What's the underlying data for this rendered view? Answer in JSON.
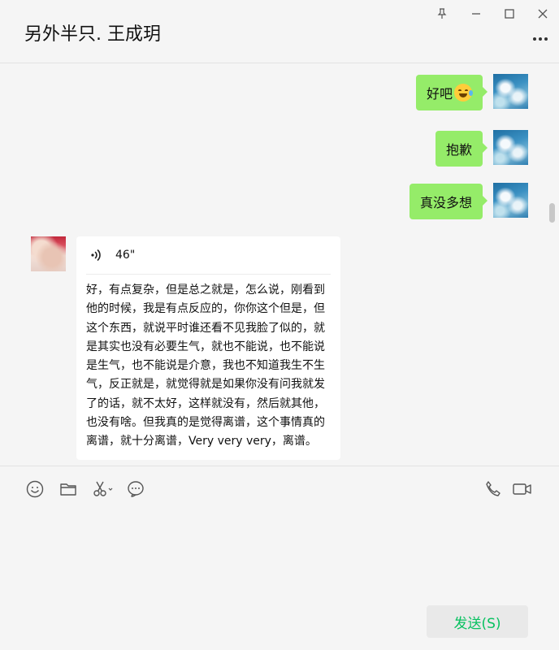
{
  "window": {
    "title": "另外半只. 王成玥",
    "controls": [
      "pin-icon",
      "minimize-icon",
      "maximize-icon",
      "close-icon",
      "more-icon"
    ]
  },
  "messages": {
    "outgoing": [
      {
        "text": "好吧",
        "emoji": "tears-of-joy-emoji"
      },
      {
        "text": "抱歉"
      },
      {
        "text": "真没多想"
      }
    ],
    "incoming": {
      "voice_duration": "46\"",
      "transcript": "好，有点复杂，但是总之就是，怎么说，刚看到他的时候，我是有点反应的，你你这个但是，但这个东西，就说平时谁还看不见我脸了似的，就是其实也没有必要生气，就也不能说，也不能说是生气，也不能说是介意，我也不知道我生不生气，反正就是，就觉得就是如果你没有问我就发了的话，就不太好，这样就没有，然后就其他，也没有啥。但我真的是觉得离谱，这个事情真的离谱，就十分离谱，Very very very，离谱。"
    }
  },
  "toolbar": {
    "icons": [
      "emoji-icon",
      "folder-icon",
      "scissors-icon",
      "chat-bubble-icon",
      "phone-icon",
      "video-icon"
    ]
  },
  "input": {
    "value": ""
  },
  "send_button": {
    "label": "发送(S)"
  },
  "colors": {
    "outgoing_bubble": "#95ec69",
    "incoming_bubble": "#ffffff",
    "send_text": "#07c160"
  }
}
